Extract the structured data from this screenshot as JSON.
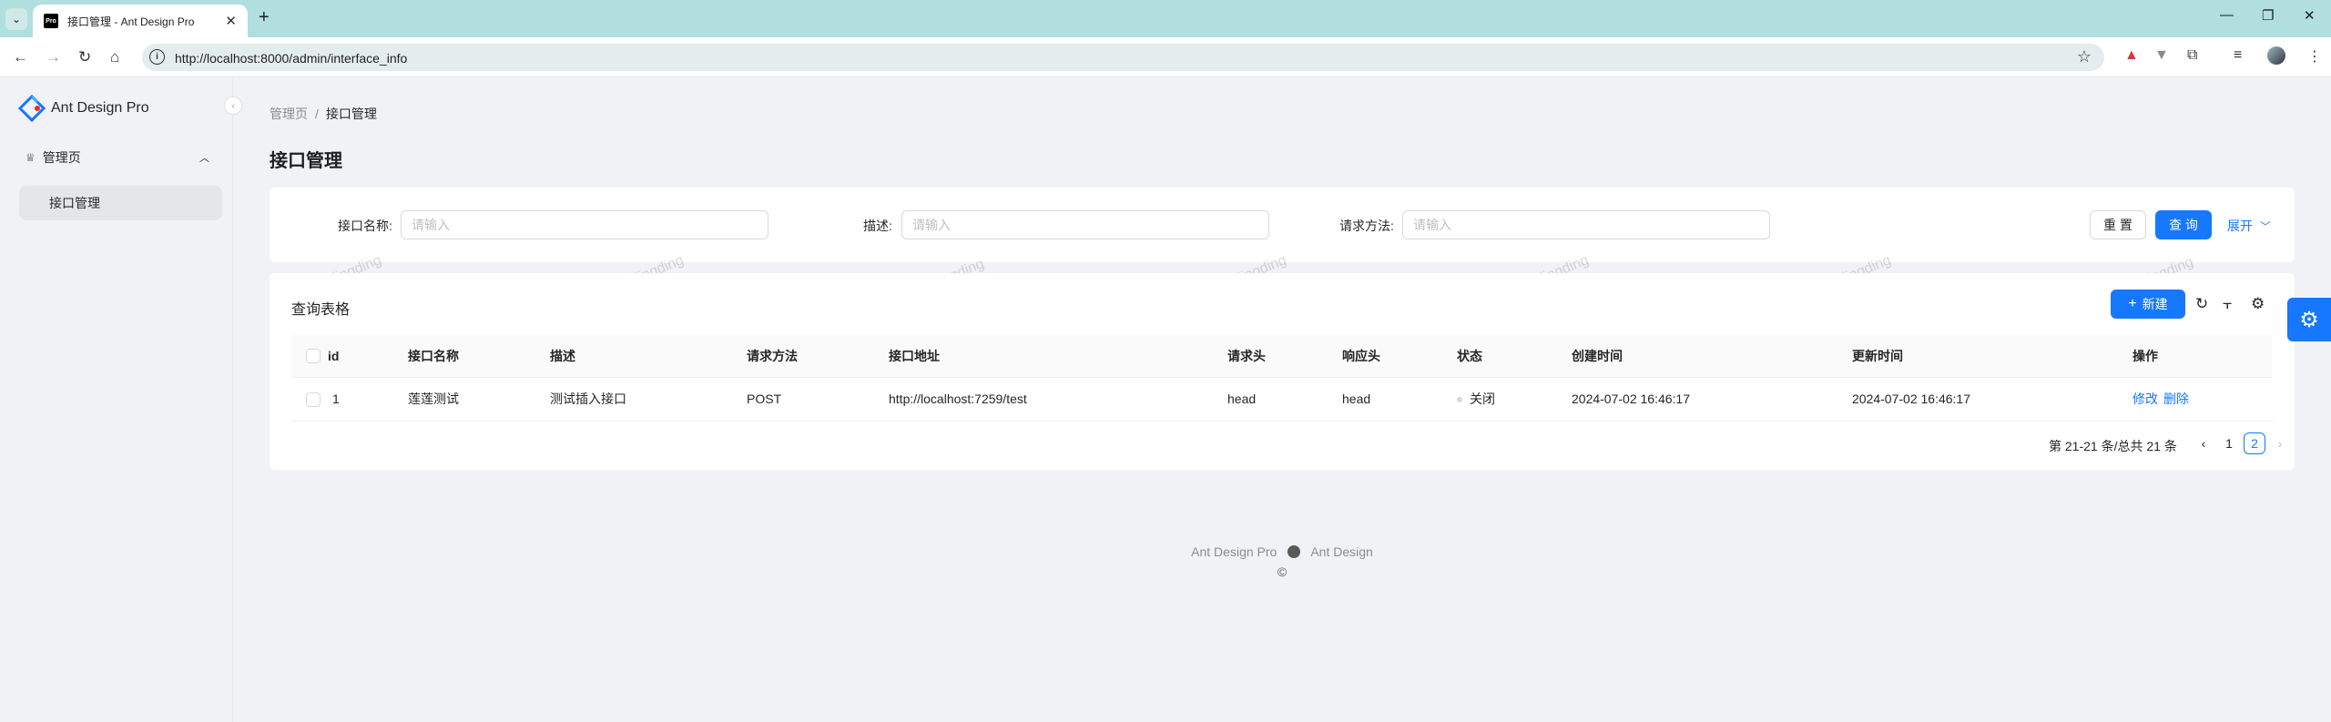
{
  "browser": {
    "tab_title": "接口管理 - Ant Design Pro",
    "favicon_text": "Pro",
    "url": "http://localhost:8000/admin/interface_info"
  },
  "app": {
    "logo_text": "Ant Design Pro",
    "menu_group": "管理页",
    "menu_item": "接口管理"
  },
  "breadcrumb": {
    "parent": "管理页",
    "separator": "/",
    "current": "接口管理"
  },
  "page_title": "接口管理",
  "search": {
    "fields": [
      {
        "label": "接口名称:",
        "placeholder": "请输入"
      },
      {
        "label": "描述:",
        "placeholder": "请输入"
      },
      {
        "label": "请求方法:",
        "placeholder": "请输入"
      }
    ],
    "reset_label": "重 置",
    "query_label": "查 询",
    "expand_label": "展开"
  },
  "table": {
    "title": "查询表格",
    "new_label": "新建",
    "columns": [
      "id",
      "接口名称",
      "描述",
      "请求方法",
      "接口地址",
      "请求头",
      "响应头",
      "状态",
      "创建时间",
      "更新时间",
      "操作"
    ],
    "rows": [
      {
        "id": "1",
        "name": "莲莲测试",
        "description": "测试插入接口",
        "method": "POST",
        "url": "http://localhost:7259/test",
        "request_header": "head",
        "response_header": "head",
        "status": "关闭",
        "created": "2024-07-02 16:46:17",
        "updated": "2024-07-02 16:46:17",
        "edit": "修改",
        "delete": "删除"
      }
    ],
    "pagination": {
      "summary": "第 21-21 条/总共 21 条",
      "page1": "1",
      "page2": "2"
    }
  },
  "watermark": "dingding",
  "footer": {
    "link1": "Ant Design Pro",
    "link2": "Ant Design",
    "copyright": "©"
  },
  "colors": {
    "primary": "#1677ff",
    "tabbar": "#b1dede"
  }
}
